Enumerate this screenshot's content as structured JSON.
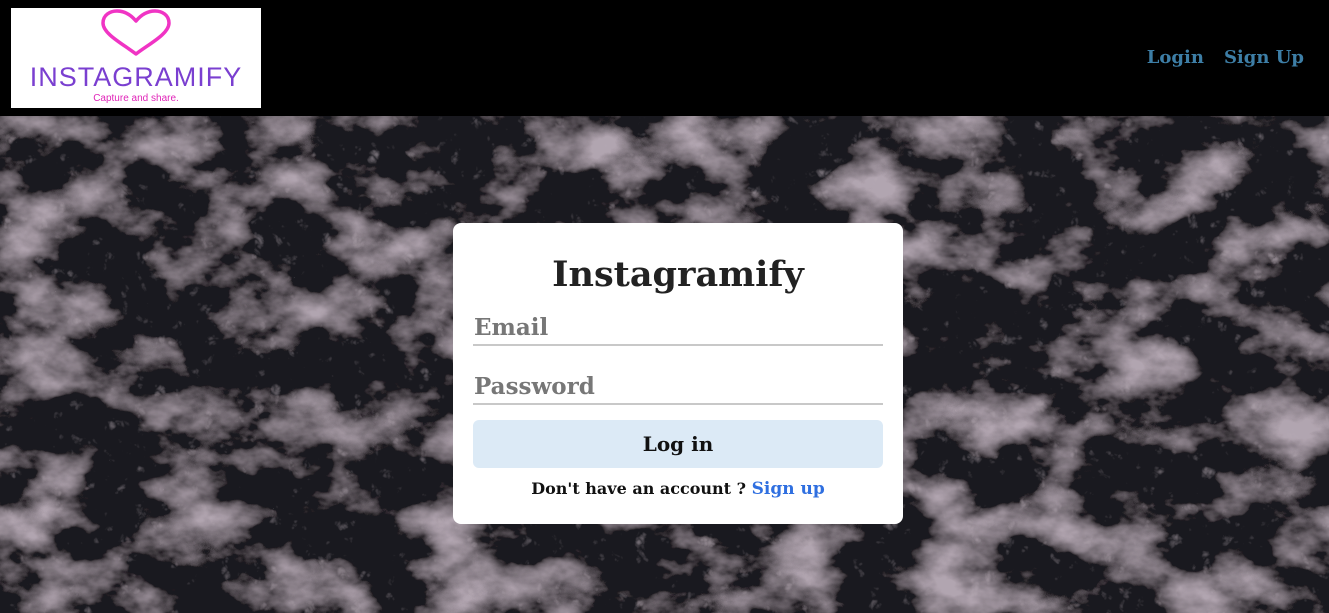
{
  "nav": {
    "logo": {
      "brand": "INSTAGRAMIFY",
      "tagline": "Capture and share.",
      "icon": "heart-icon"
    },
    "login_label": "Login",
    "signup_label": "Sign Up"
  },
  "card": {
    "title": "Instagramify",
    "email_placeholder": "Email",
    "password_placeholder": "Password",
    "login_button": "Log in",
    "no_account_text": "Don't have an account ?",
    "signup_link": "Sign up"
  },
  "colors": {
    "nav_link": "#3d7ea6",
    "signup_link": "#2f6fe0",
    "button_bg": "#dceaf6",
    "logo_heart": "#f034c4",
    "logo_text": "#7a3fd0"
  }
}
